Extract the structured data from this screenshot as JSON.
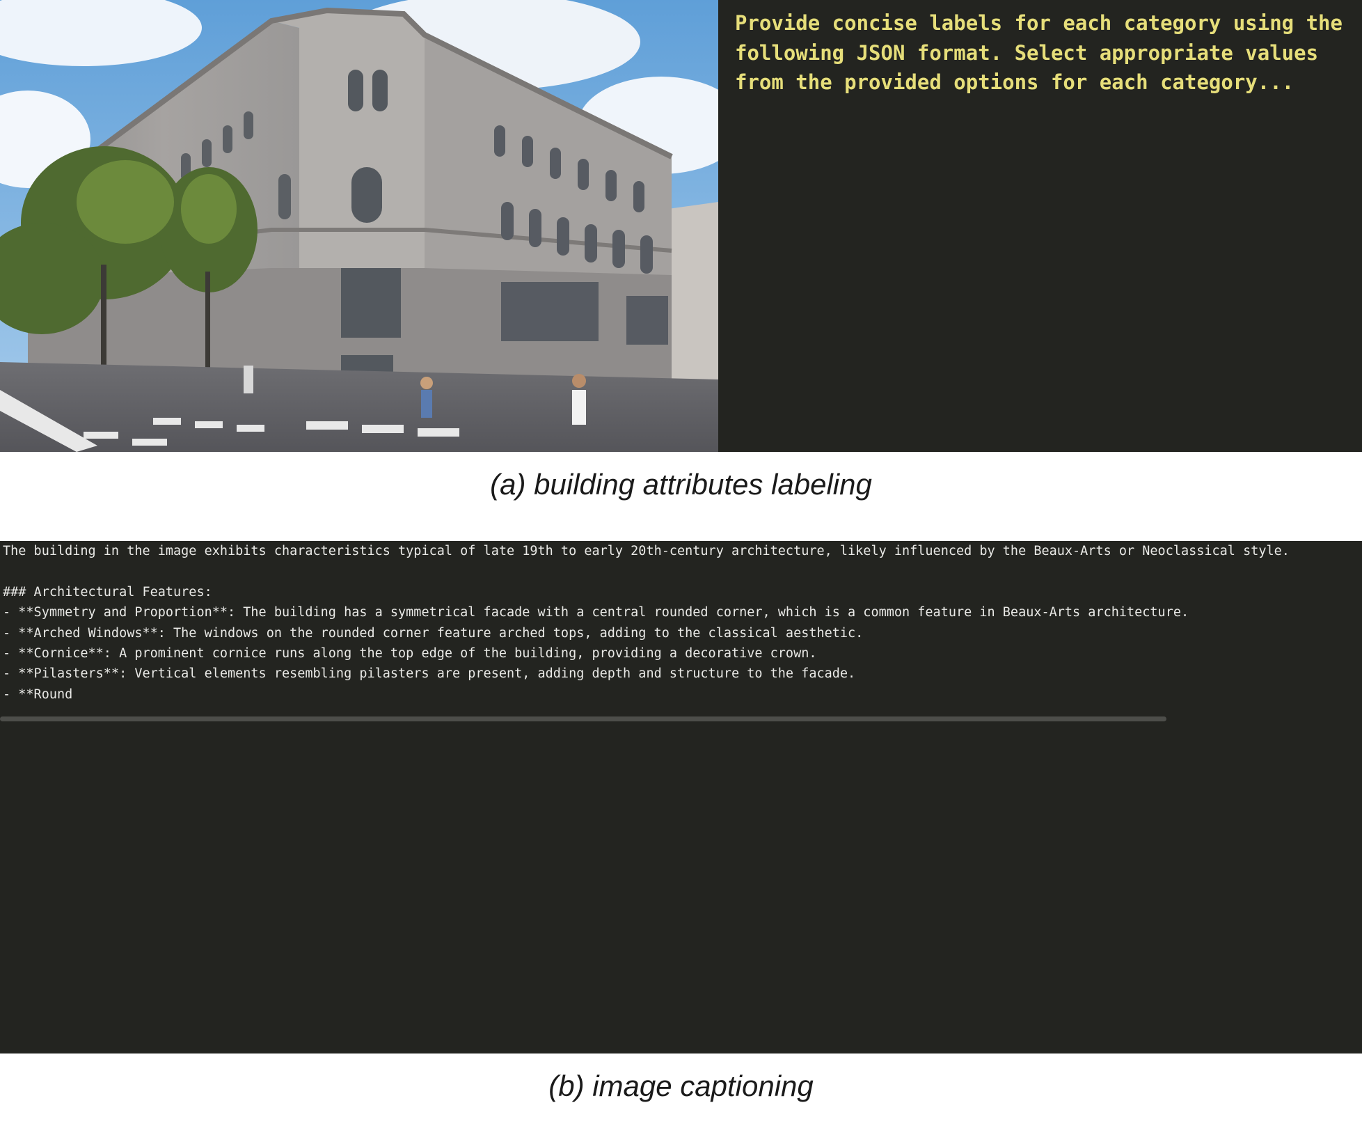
{
  "panel_a": {
    "photo_subject": "street-view photo of a neoclassical corner building",
    "prompt_text": "Provide concise labels for each category using the following JSON format. Select appropriate values from the provided options for each category...",
    "caption": "(a) building attributes labeling"
  },
  "panel_b": {
    "output_lines": [
      "The building in the image exhibits characteristics typical of late 19th to early 20th-century architecture, likely influenced by the Beaux-Arts or Neoclassical style.",
      "",
      "### Architectural Features:",
      "- **Symmetry and Proportion**: The building has a symmetrical facade with a central rounded corner, which is a common feature in Beaux-Arts architecture.",
      "- **Arched Windows**: The windows on the rounded corner feature arched tops, adding to the classical aesthetic.",
      "- **Cornice**: A prominent cornice runs along the top edge of the building, providing a decorative crown.",
      "- **Pilasters**: Vertical elements resembling pilasters are present, adding depth and structure to the facade.",
      "- **Round"
    ],
    "caption": "(b) image captioning"
  },
  "colors": {
    "terminal_bg": "#232420",
    "prompt_text": "#e6de7a",
    "output_text": "#e9e9e6",
    "caption_text": "#1a1a1a"
  }
}
